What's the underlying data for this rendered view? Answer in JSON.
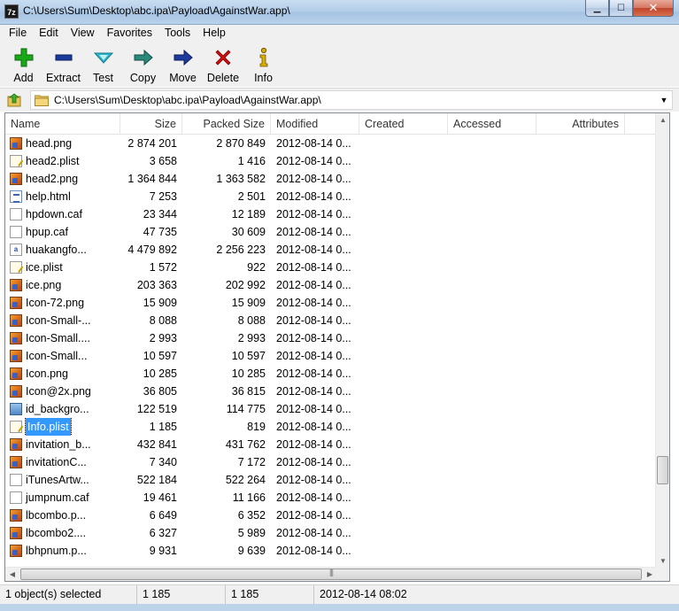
{
  "window": {
    "app_icon_text": "7z",
    "title": "C:\\Users\\Sum\\Desktop\\abc.ipa\\Payload\\AgainstWar.app\\",
    "controls": {
      "minimize": "▁",
      "maximize": "☐",
      "close": "✕"
    }
  },
  "menu": [
    "File",
    "Edit",
    "View",
    "Favorites",
    "Tools",
    "Help"
  ],
  "toolbar": {
    "add": "Add",
    "extract": "Extract",
    "test": "Test",
    "copy": "Copy",
    "move": "Move",
    "delete": "Delete",
    "info": "Info",
    "colors": {
      "add": "#1aa81a",
      "extract": "#1b3a9c",
      "test": "#2bb5c8",
      "copy": "#2a8a7a",
      "move": "#1b3a9c",
      "delete": "#d01010",
      "info": "#d8b000"
    }
  },
  "address": {
    "path": "C:\\Users\\Sum\\Desktop\\abc.ipa\\Payload\\AgainstWar.app\\",
    "dropdown": "▼"
  },
  "columns": {
    "name": "Name",
    "size": "Size",
    "packed": "Packed Size",
    "modified": "Modified",
    "created": "Created",
    "accessed": "Accessed",
    "attributes": "Attributes"
  },
  "files": [
    {
      "name": "head.png",
      "size": "2 874 201",
      "packed": "2 870 849",
      "modified": "2012-08-14 0...",
      "icon": "image-file-icon"
    },
    {
      "name": "head2.plist",
      "size": "3 658",
      "packed": "1 416",
      "modified": "2012-08-14 0...",
      "icon": "plist-file-icon"
    },
    {
      "name": "head2.png",
      "size": "1 364 844",
      "packed": "1 363 582",
      "modified": "2012-08-14 0...",
      "icon": "image-file-icon"
    },
    {
      "name": "help.html",
      "size": "7 253",
      "packed": "2 501",
      "modified": "2012-08-14 0...",
      "icon": "html-file-icon"
    },
    {
      "name": "hpdown.caf",
      "size": "23 344",
      "packed": "12 189",
      "modified": "2012-08-14 0...",
      "icon": "blank-file-icon"
    },
    {
      "name": "hpup.caf",
      "size": "47 735",
      "packed": "30 609",
      "modified": "2012-08-14 0...",
      "icon": "blank-file-icon"
    },
    {
      "name": "huakangfo...",
      "size": "4 479 892",
      "packed": "2 256 223",
      "modified": "2012-08-14 0...",
      "icon": "font-file-icon"
    },
    {
      "name": "ice.plist",
      "size": "1 572",
      "packed": "922",
      "modified": "2012-08-14 0...",
      "icon": "plist-file-icon"
    },
    {
      "name": "ice.png",
      "size": "203 363",
      "packed": "202 992",
      "modified": "2012-08-14 0...",
      "icon": "image-file-icon"
    },
    {
      "name": "Icon-72.png",
      "size": "15 909",
      "packed": "15 909",
      "modified": "2012-08-14 0...",
      "icon": "image-file-icon"
    },
    {
      "name": "Icon-Small-...",
      "size": "8 088",
      "packed": "8 088",
      "modified": "2012-08-14 0...",
      "icon": "image-file-icon"
    },
    {
      "name": "Icon-Small....",
      "size": "2 993",
      "packed": "2 993",
      "modified": "2012-08-14 0...",
      "icon": "image-file-icon"
    },
    {
      "name": "Icon-Small...",
      "size": "10 597",
      "packed": "10 597",
      "modified": "2012-08-14 0...",
      "icon": "image-file-icon"
    },
    {
      "name": "Icon.png",
      "size": "10 285",
      "packed": "10 285",
      "modified": "2012-08-14 0...",
      "icon": "image-file-icon"
    },
    {
      "name": "Icon@2x.png",
      "size": "36 805",
      "packed": "36 815",
      "modified": "2012-08-14 0...",
      "icon": "image-file-icon"
    },
    {
      "name": "id_backgro...",
      "size": "122 519",
      "packed": "114 775",
      "modified": "2012-08-14 0...",
      "icon": "picture-file-icon"
    },
    {
      "name": "Info.plist",
      "size": "1 185",
      "packed": "819",
      "modified": "2012-08-14 0...",
      "icon": "plist-file-icon",
      "selected": true
    },
    {
      "name": "invitation_b...",
      "size": "432 841",
      "packed": "431 762",
      "modified": "2012-08-14 0...",
      "icon": "image-file-icon"
    },
    {
      "name": "invitationC...",
      "size": "7 340",
      "packed": "7 172",
      "modified": "2012-08-14 0...",
      "icon": "image-file-icon"
    },
    {
      "name": "iTunesArtw...",
      "size": "522 184",
      "packed": "522 264",
      "modified": "2012-08-14 0...",
      "icon": "blank-file-icon"
    },
    {
      "name": "jumpnum.caf",
      "size": "19 461",
      "packed": "11 166",
      "modified": "2012-08-14 0...",
      "icon": "blank-file-icon"
    },
    {
      "name": "lbcombo.p...",
      "size": "6 649",
      "packed": "6 352",
      "modified": "2012-08-14 0...",
      "icon": "image-file-icon"
    },
    {
      "name": "lbcombo2....",
      "size": "6 327",
      "packed": "5 989",
      "modified": "2012-08-14 0...",
      "icon": "image-file-icon"
    },
    {
      "name": "lbhpnum.p...",
      "size": "9 931",
      "packed": "9 639",
      "modified": "2012-08-14 0...",
      "icon": "image-file-icon"
    }
  ],
  "scroll": {
    "up": "▲",
    "down": "▼",
    "left": "◀",
    "right": "▶",
    "grip": "|||"
  },
  "status": {
    "selected": "1 object(s) selected",
    "size": "1 185",
    "packed": "1 185",
    "modified": "2012-08-14 08:02"
  }
}
